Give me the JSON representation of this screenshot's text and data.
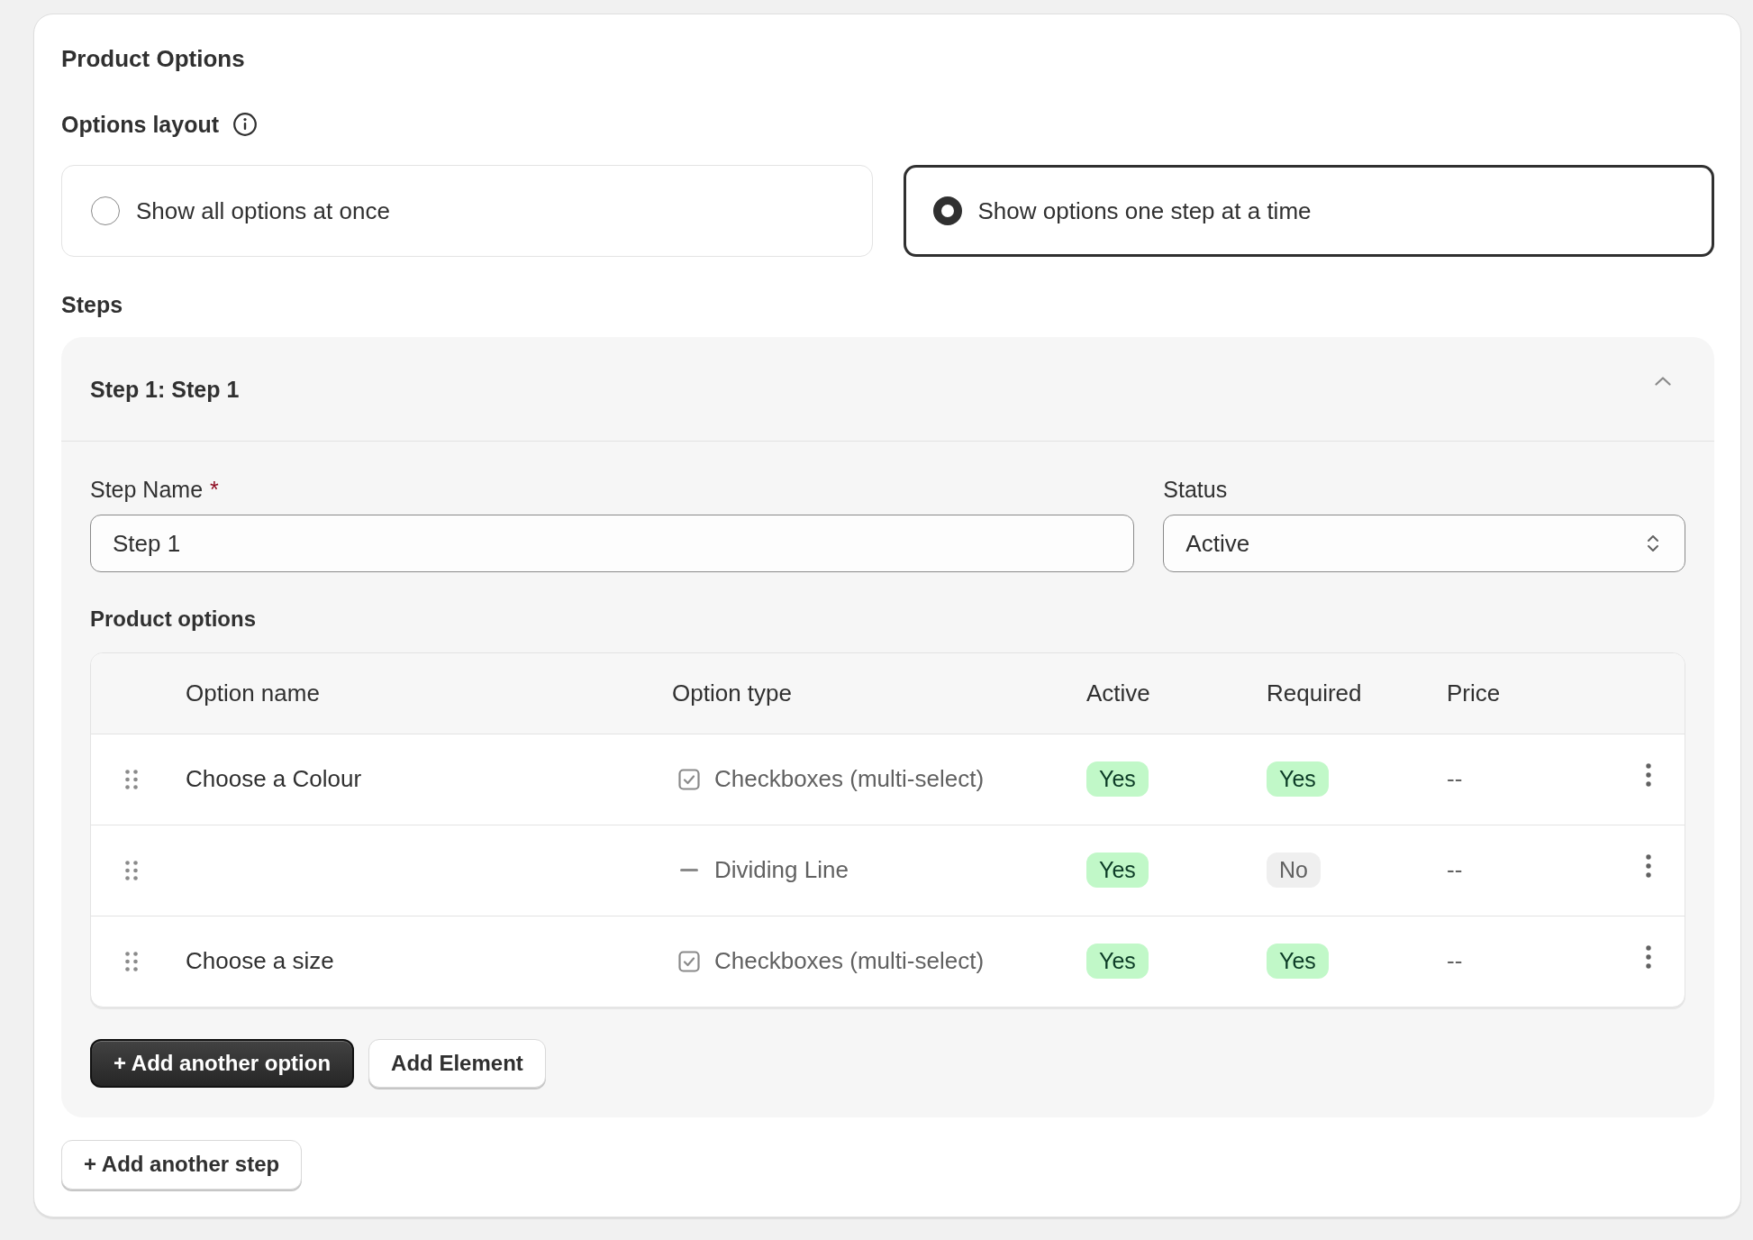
{
  "card": {
    "title": "Product Options"
  },
  "options_layout": {
    "label": "Options layout",
    "choices": [
      {
        "label": "Show all options at once",
        "selected": false
      },
      {
        "label": "Show options one step at a time",
        "selected": true
      }
    ]
  },
  "steps": {
    "heading": "Steps",
    "items": [
      {
        "title": "Step 1: Step 1",
        "expanded": true,
        "step_name": {
          "label": "Step Name",
          "required_mark": "*",
          "value": "Step 1"
        },
        "status": {
          "label": "Status",
          "value": "Active"
        },
        "product_options": {
          "heading": "Product options",
          "columns": [
            "Option name",
            "Option type",
            "Active",
            "Required",
            "Price"
          ],
          "rows": [
            {
              "name": "Choose a Colour",
              "type": {
                "kind": "checkboxes",
                "label": "Checkboxes (multi-select)"
              },
              "active": {
                "label": "Yes",
                "on": true
              },
              "required": {
                "label": "Yes",
                "on": true
              },
              "price": "--"
            },
            {
              "type": {
                "kind": "divider",
                "label": "Dividing Line"
              },
              "active": {
                "label": "Yes",
                "on": true
              },
              "required": {
                "label": "No",
                "on": false
              },
              "price": "--"
            },
            {
              "name": "Choose a size",
              "type": {
                "kind": "checkboxes",
                "label": "Checkboxes (multi-select)"
              },
              "active": {
                "label": "Yes",
                "on": true
              },
              "required": {
                "label": "Yes",
                "on": true
              },
              "price": "--"
            }
          ]
        },
        "buttons": [
          {
            "label": "+ Add another option",
            "kind": "primary"
          },
          {
            "label": "Add Element",
            "kind": "secondary"
          }
        ]
      }
    ],
    "add_button": "+ Add another step"
  }
}
